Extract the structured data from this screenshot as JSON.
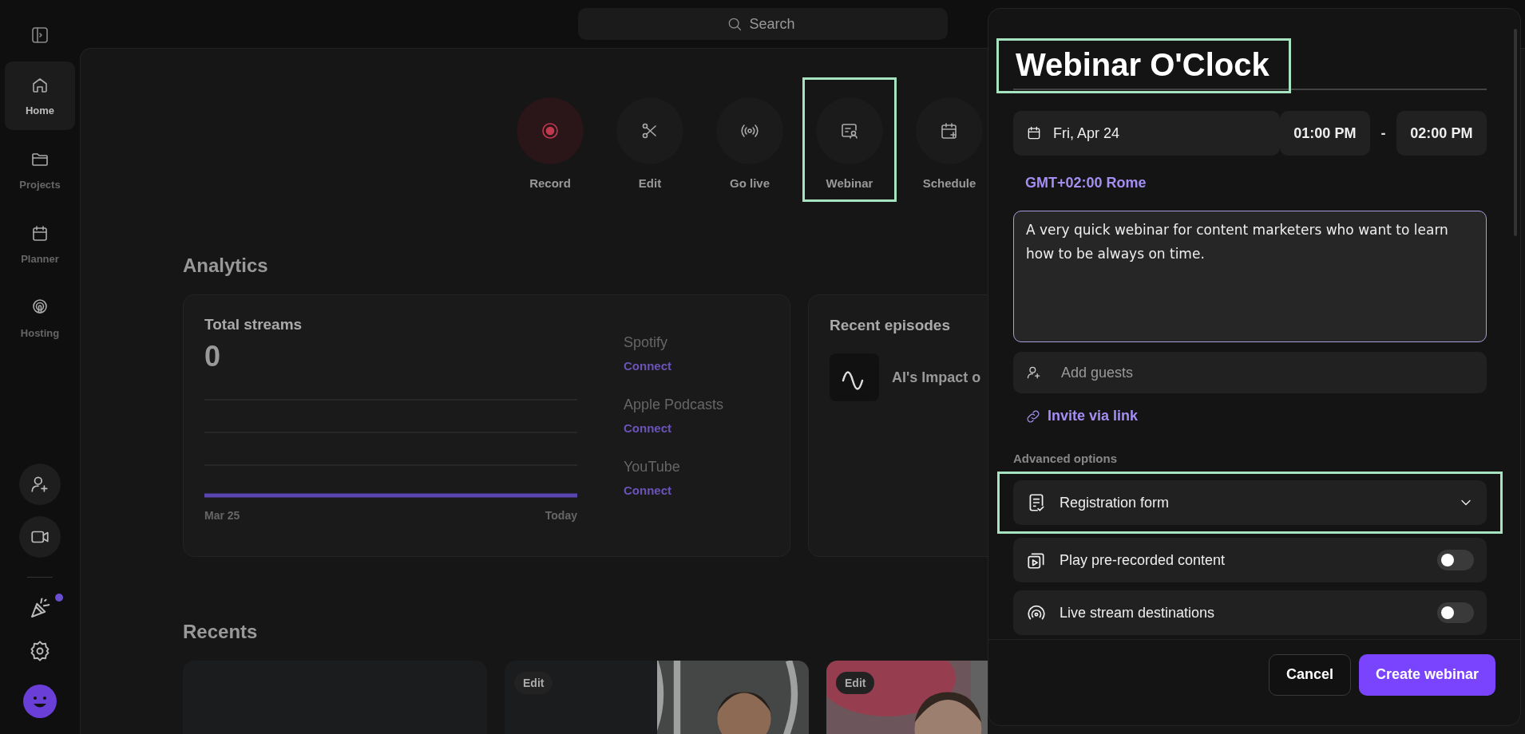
{
  "sidebar": {
    "items": [
      {
        "label": "Home",
        "selected": true
      },
      {
        "label": "Projects",
        "selected": false
      },
      {
        "label": "Planner",
        "selected": false
      },
      {
        "label": "Hosting",
        "selected": false
      }
    ],
    "notification_dot": true
  },
  "search": {
    "placeholder": "Search"
  },
  "actions": [
    {
      "label": "Record",
      "highlighted": false
    },
    {
      "label": "Edit",
      "highlighted": false
    },
    {
      "label": "Go live",
      "highlighted": false
    },
    {
      "label": "Webinar",
      "highlighted": true
    },
    {
      "label": "Schedule",
      "highlighted": false
    }
  ],
  "analytics": {
    "title": "Analytics",
    "total_streams": {
      "title": "Total streams",
      "value": "0",
      "x_start": "Mar 25",
      "x_end": "Today"
    },
    "platforms": [
      {
        "name": "Spotify",
        "action": "Connect"
      },
      {
        "name": "Apple Podcasts",
        "action": "Connect"
      },
      {
        "name": "YouTube",
        "action": "Connect"
      }
    ]
  },
  "recent_episodes": {
    "title": "Recent episodes",
    "items": [
      {
        "title": "AI's Impact o"
      }
    ]
  },
  "recents": {
    "title": "Recents",
    "items": [
      {
        "kind": "blank"
      },
      {
        "kind": "picture",
        "badge": "Edit"
      },
      {
        "kind": "picture",
        "badge": "Edit"
      }
    ]
  },
  "modal": {
    "title": "Webinar O'Clock",
    "title_highlighted": true,
    "date": "Fri, Apr 24",
    "start_time": "01:00 PM",
    "separator": "-",
    "end_time": "02:00 PM",
    "timezone": "GMT+02:00 Rome",
    "description": "A very quick webinar for content marketers who want to learn how to be always on time.",
    "guests_field": {
      "placeholder": "Add guests"
    },
    "invite_link": "Invite via link",
    "advanced_label": "Advanced options",
    "options": [
      {
        "kind": "dropdown",
        "label": "Registration form",
        "highlighted": true,
        "expanded": false
      },
      {
        "kind": "toggle",
        "label": "Play pre-recorded content",
        "on": false,
        "highlighted": false
      },
      {
        "kind": "toggle",
        "label": "Live stream destinations",
        "on": false,
        "highlighted": false
      }
    ],
    "buttons": [
      {
        "label": "Cancel",
        "kind": "secondary"
      },
      {
        "label": "Create webinar",
        "kind": "primary"
      }
    ]
  }
}
